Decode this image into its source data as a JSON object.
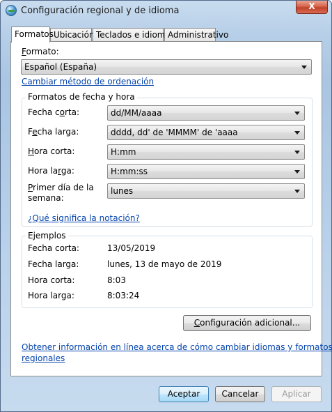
{
  "window": {
    "title": "Configuración regional y de idioma",
    "close_glyph": "X"
  },
  "tabs": [
    {
      "label": "Formatos",
      "active": true
    },
    {
      "label": "Ubicación"
    },
    {
      "label": "Teclados e idiomas"
    },
    {
      "label": "Administrativo"
    }
  ],
  "format": {
    "label_prefix": "",
    "label_accel": "F",
    "label_rest": "ormato:",
    "value": "Español (España)",
    "sort_link_prefix": "Cambiar ",
    "sort_link_accel": "m",
    "sort_link_rest": "étodo de ordenación"
  },
  "date_time_formats": {
    "title": "Formatos de fecha y hora",
    "short_date": {
      "label_a": "Fecha c",
      "label_accel": "o",
      "label_b": "rta:",
      "value": "dd/MM/aaaa"
    },
    "long_date": {
      "label_a": "F",
      "label_accel": "e",
      "label_b": "cha larga:",
      "value": "dddd, dd' de 'MMMM' de 'aaaa"
    },
    "short_time": {
      "label_a": "",
      "label_accel": "H",
      "label_b": "ora corta:",
      "value": "H:mm"
    },
    "long_time": {
      "label_a": "Hora la",
      "label_accel": "r",
      "label_b": "ga:",
      "value": "H:mm:ss"
    },
    "first_day": {
      "label_line1_a": "",
      "label_line1_accel": "P",
      "label_line1_b": "rimer día de la",
      "label_line2": "semana:",
      "value": "lunes"
    },
    "notation_link": "¿Qué significa la notación?"
  },
  "examples": {
    "title": "Ejemplos",
    "rows": [
      {
        "label": "Fecha corta:",
        "value": "13/05/2019"
      },
      {
        "label": "Fecha larga:",
        "value": "lunes, 13 de mayo de 2019"
      },
      {
        "label": "Hora corta:",
        "value": "8:03"
      },
      {
        "label": "Hora larga:",
        "value": "8:03:24"
      }
    ]
  },
  "additional_settings_button": {
    "accel": "C",
    "rest": "onfiguración adicional..."
  },
  "online_info_link": {
    "line1": "Obtener información en línea acerca de cómo cambiar idiomas y formatos",
    "line2": "regionales"
  },
  "footer": {
    "ok": "Aceptar",
    "cancel": "Cancelar",
    "apply": "Aplicar"
  }
}
